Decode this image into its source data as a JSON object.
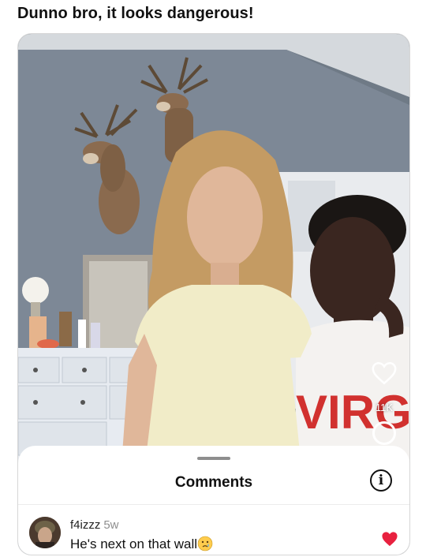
{
  "post": {
    "caption": "Dunno bro, it looks dangerous!"
  },
  "video": {
    "like_count": "11K",
    "shirt_print": "VIRG"
  },
  "comments_sheet": {
    "title": "Comments",
    "info_icon": "info-circle-icon",
    "comment": {
      "username": "f4izzz",
      "time_ago": "5w",
      "text": "He's next on that wall",
      "emoji": "crying-face-emoji",
      "liked_color": "#e8213f"
    }
  },
  "colors": {
    "wall": "#7d8896",
    "dress": "#f1ecc8",
    "dresser": "#e7ebf1",
    "like_red": "#e8213f"
  }
}
